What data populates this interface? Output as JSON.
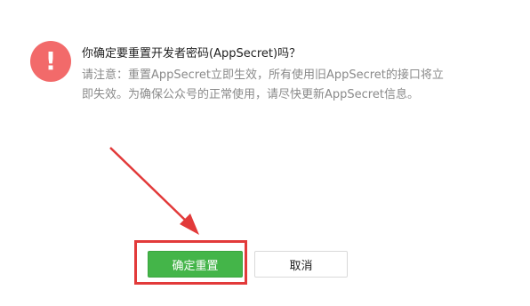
{
  "dialog": {
    "icon_glyph": "!",
    "icon_name": "warning-icon",
    "icon_color": "#f26a6a",
    "title": "你确定要重置开发者密码(AppSecret)吗？",
    "desc_line1": "请注意：重置AppSecret立即生效，所有使用旧AppSecret的接口将立",
    "desc_line2": "即失效。为确保公众号的正常使用，请尽快更新AppSecret信息。",
    "confirm_label": "确定重置",
    "cancel_label": "取消",
    "confirm_color": "#44b549",
    "annotation_color": "#e23a3a"
  }
}
